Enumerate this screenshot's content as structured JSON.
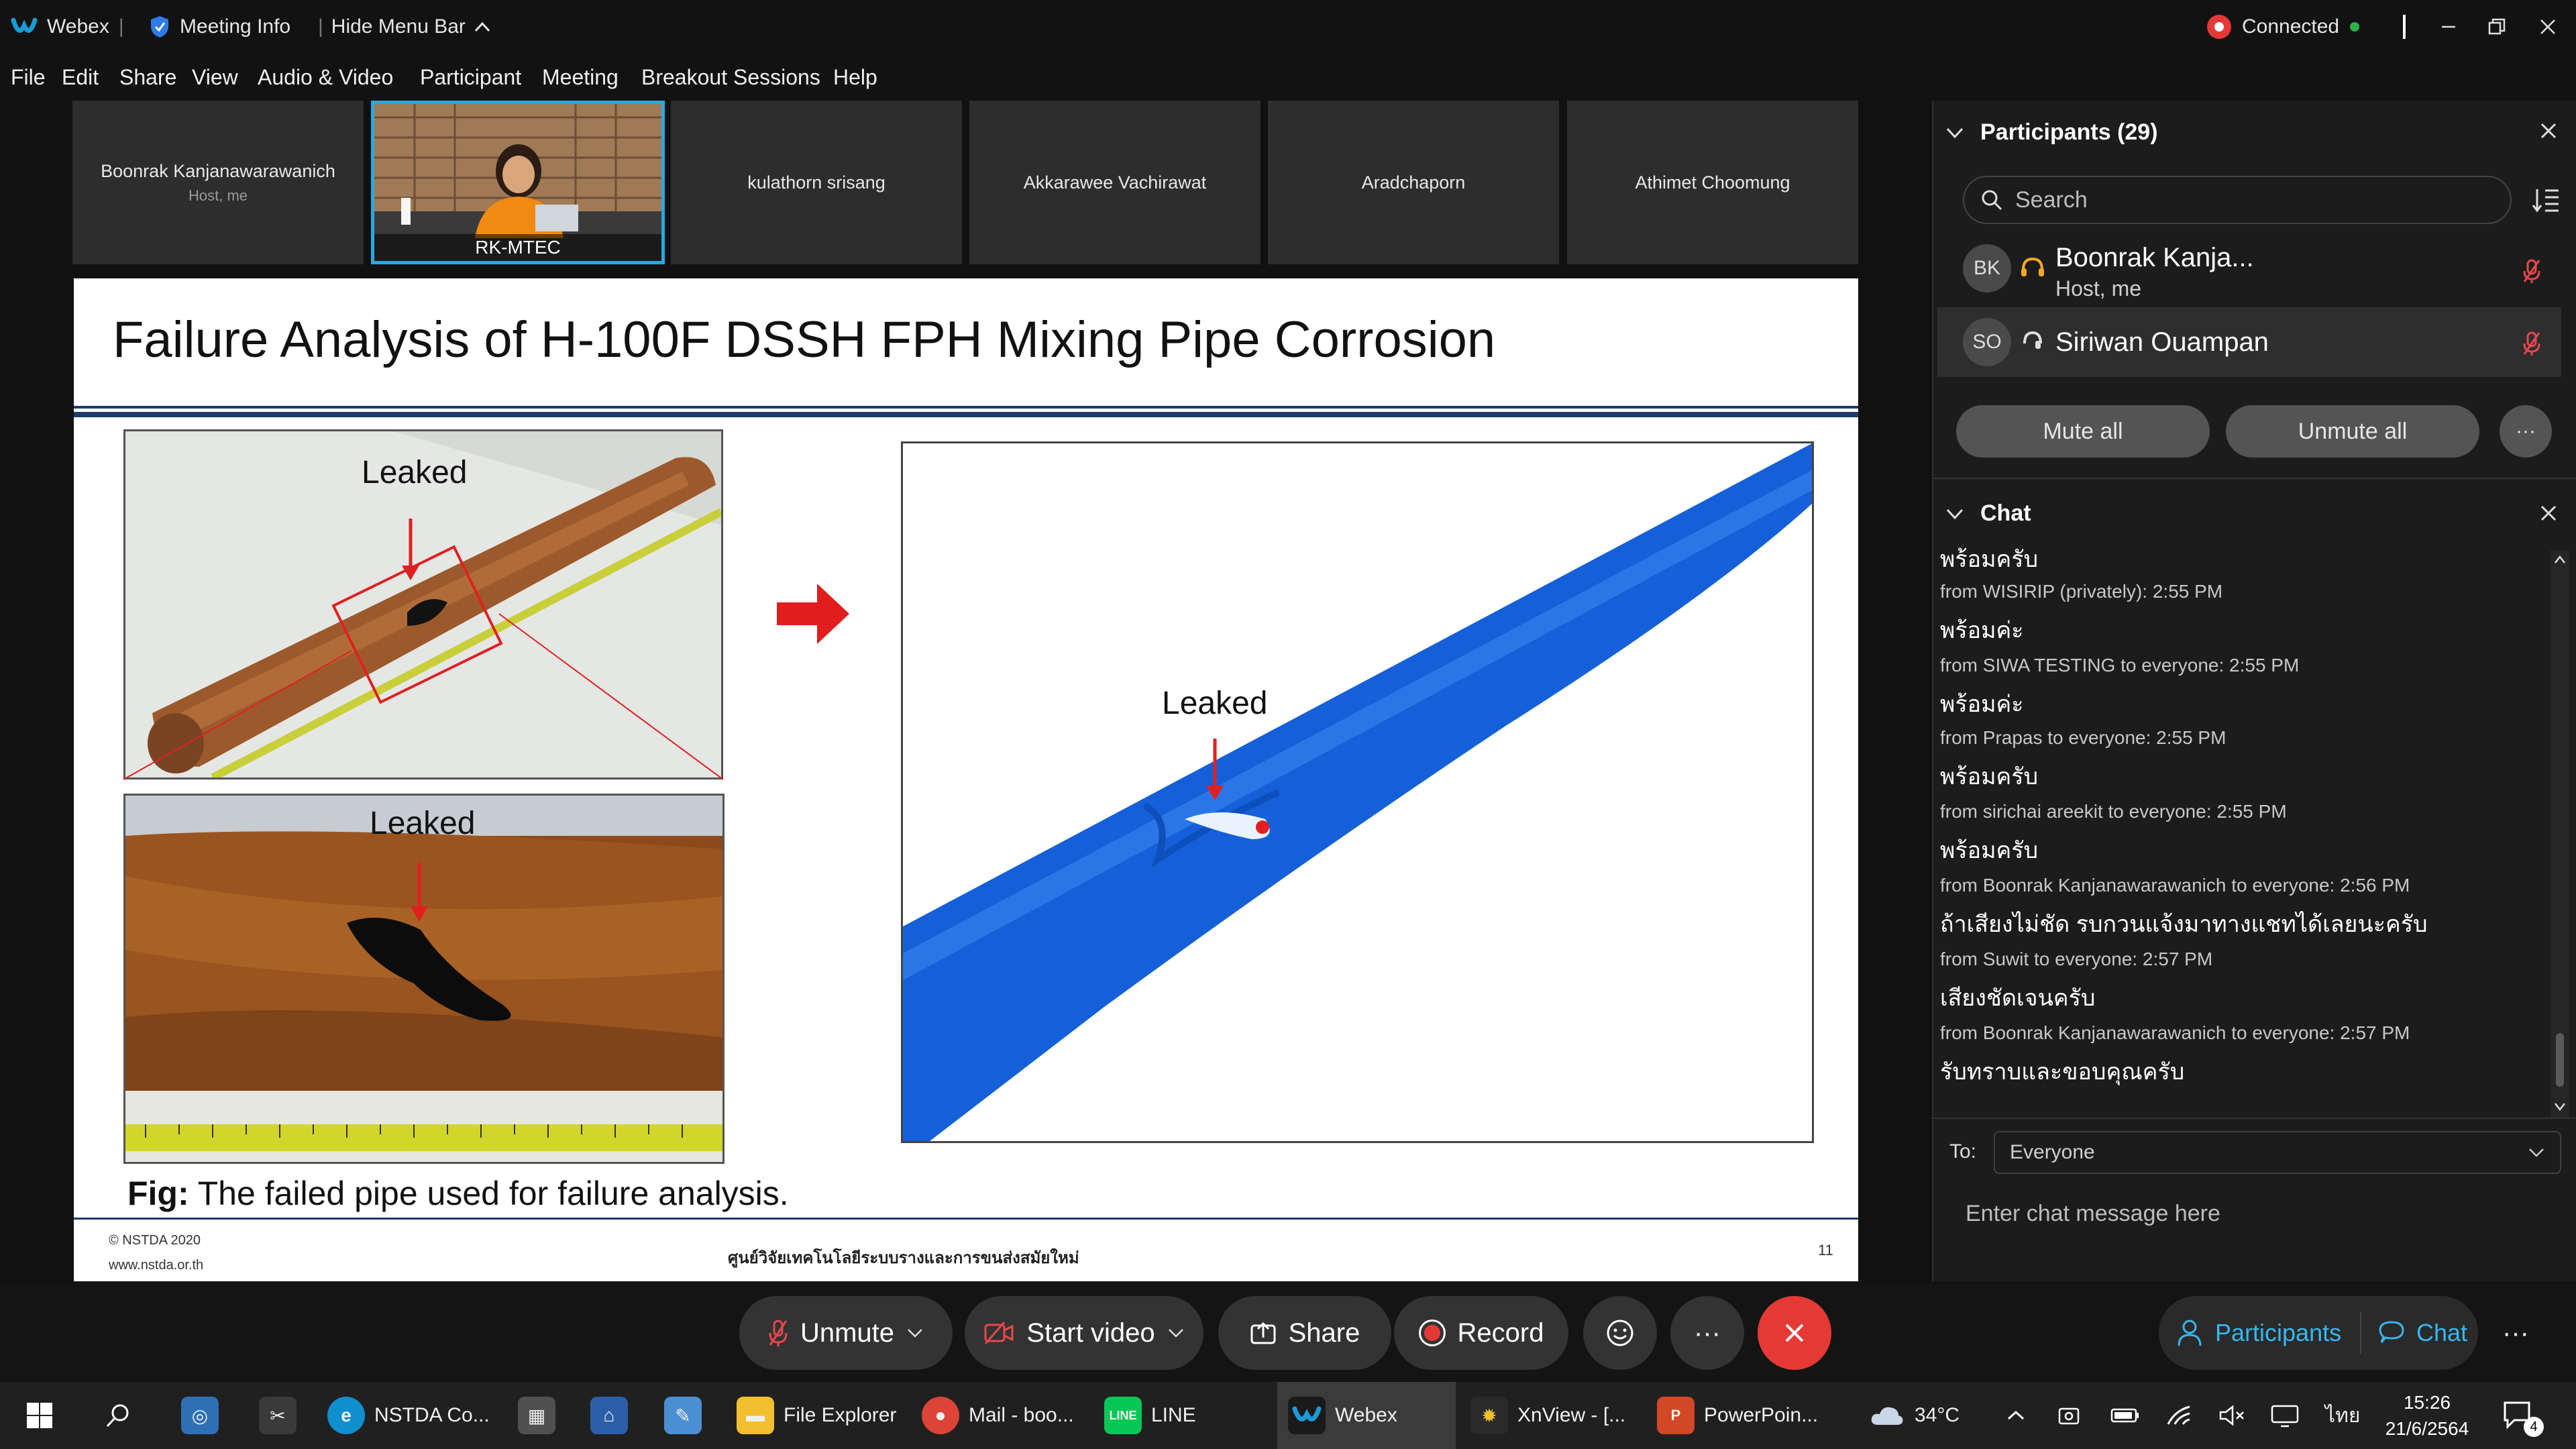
{
  "titlebar": {
    "app_name": "Webex",
    "meeting_info": "Meeting Info",
    "hide_menu": "Hide Menu Bar",
    "connection": "Connected"
  },
  "menu": [
    "File",
    "Edit",
    "Share",
    "View",
    "Audio & Video",
    "Participant",
    "Meeting",
    "Breakout Sessions",
    "Help"
  ],
  "video_strip": [
    {
      "name": "Boonrak Kanjanawarawanich",
      "sub": "Host, me"
    },
    {
      "name": "RK-MTEC",
      "sub": ""
    },
    {
      "name": "kulathorn srisang",
      "sub": ""
    },
    {
      "name": "Akkarawee Vachirawat",
      "sub": ""
    },
    {
      "name": "Aradchaporn",
      "sub": ""
    },
    {
      "name": "Athimet Choomung",
      "sub": ""
    }
  ],
  "slide": {
    "title": "Failure Analysis of H-100F DSSH FPH Mixing Pipe Corrosion",
    "leaked1": "Leaked",
    "leaked2": "Leaked",
    "leaked3": "Leaked",
    "fig_bold": "Fig:",
    "fig_text": " The failed pipe used for failure analysis.",
    "footer_left1": "© NSTDA 2020",
    "footer_left2": "www.nstda.or.th",
    "footer_center": "ศูนย์วิจัยเทคโนโลยีระบบรางและการขนส่งสมัยใหม่",
    "page_number": "11"
  },
  "participants_panel": {
    "header": "Participants (29)",
    "search_placeholder": "Search",
    "people": [
      {
        "initials": "BK",
        "name": "Boonrak Kanja...",
        "role": "Host, me"
      },
      {
        "initials": "SO",
        "name": "Siriwan Ouampan",
        "role": ""
      }
    ],
    "mute_all": "Mute all",
    "unmute_all": "Unmute all"
  },
  "chat_panel": {
    "header": "Chat",
    "partial_top": "พร้อมครับ",
    "messages": [
      {
        "meta": "from WISIRIP (privately):    2:55 PM",
        "text": "พร้อมค่ะ"
      },
      {
        "meta": "from SIWA TESTING to everyone:    2:55 PM",
        "text": "พร้อมค่ะ"
      },
      {
        "meta": "from Prapas to everyone:    2:55 PM",
        "text": "พร้อมครับ"
      },
      {
        "meta": "from sirichai areekit to everyone:    2:55 PM",
        "text": "พร้อมครับ"
      },
      {
        "meta": "from Boonrak Kanjanawarawanich to everyone:    2:56 PM",
        "text": "ถ้าเสียงไม่ชัด รบกวนแจ้งมาทางแชทได้เลยนะครับ"
      },
      {
        "meta": "from Suwit to everyone:    2:57 PM",
        "text": "เสียงชัดเจนครับ"
      },
      {
        "meta": "from Boonrak Kanjanawarawanich to everyone:    2:57 PM",
        "text": "รับทราบและขอบคุณครับ"
      }
    ],
    "to_label": "To:",
    "to_value": "Everyone",
    "input_placeholder": "Enter chat message here"
  },
  "controls": {
    "unmute": "Unmute",
    "start_video": "Start video",
    "share": "Share",
    "record": "Record",
    "participants": "Participants",
    "chat": "Chat"
  },
  "taskbar": {
    "items": [
      "NSTDA Co...",
      "File Explorer",
      "Mail - boo...",
      "LINE",
      "Webex",
      "XnView - [...",
      "PowerPoin..."
    ],
    "weather": "34°C",
    "lang": "ไทย",
    "time": "15:26",
    "date": "21/6/2564",
    "notif_count": "4"
  },
  "colors": {
    "accent": "#1a9bd7",
    "end_call": "#e53935",
    "mic_off": "#e5484d",
    "pipe_blue": "#1560d8",
    "connected": "#29b34a"
  }
}
